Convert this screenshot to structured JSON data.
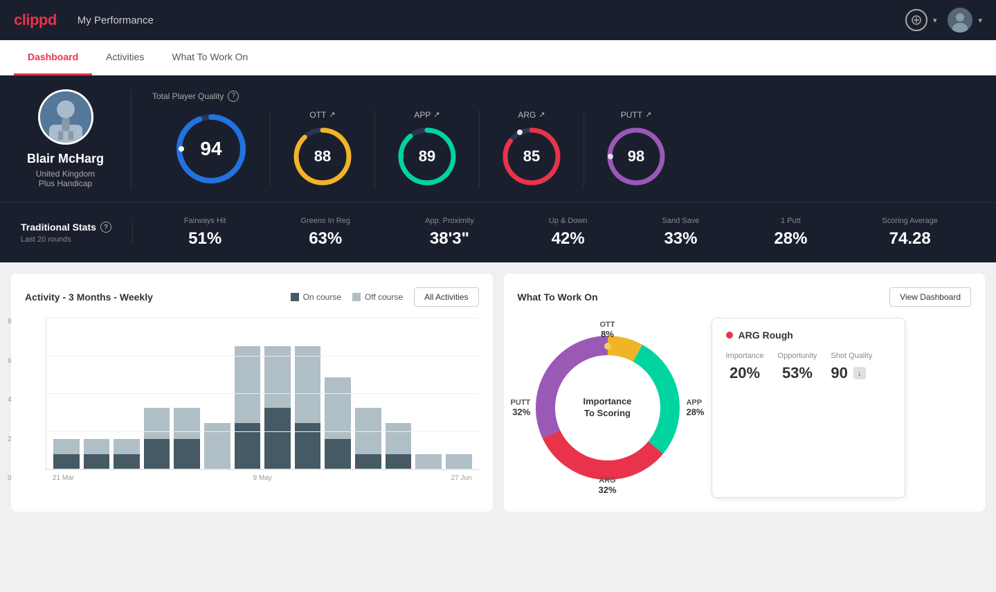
{
  "header": {
    "logo": "clippd",
    "title": "My Performance",
    "add_button_label": "+",
    "chevron": "▾"
  },
  "tabs": [
    {
      "label": "Dashboard",
      "active": true
    },
    {
      "label": "Activities",
      "active": false
    },
    {
      "label": "What To Work On",
      "active": false
    }
  ],
  "hero": {
    "player": {
      "name": "Blair McHarg",
      "country": "United Kingdom",
      "handicap": "Plus Handicap"
    },
    "quality_label": "Total Player Quality",
    "scores": [
      {
        "label": "94",
        "color_start": "#3a7bd5",
        "color_end": "#1e90ff",
        "pct": 94,
        "ring_color": "#2272e0",
        "trail_color": "#2a3555"
      },
      {
        "label": "OTT",
        "value": "88",
        "pct": 88,
        "ring_color": "#f0b429",
        "trail_color": "#2a3555"
      },
      {
        "label": "APP",
        "value": "89",
        "pct": 89,
        "ring_color": "#00d4a0",
        "trail_color": "#2a3555"
      },
      {
        "label": "ARG",
        "value": "85",
        "pct": 85,
        "ring_color": "#e8334a",
        "trail_color": "#2a3555"
      },
      {
        "label": "PUTT",
        "value": "98",
        "pct": 98,
        "ring_color": "#9b59b6",
        "trail_color": "#2a3555"
      }
    ]
  },
  "stats": {
    "section_label": "Traditional Stats",
    "help": "?",
    "rounds_label": "Last 20 rounds",
    "items": [
      {
        "name": "Fairways Hit",
        "value": "51%"
      },
      {
        "name": "Greens In Reg",
        "value": "63%"
      },
      {
        "name": "App. Proximity",
        "value": "38'3\""
      },
      {
        "name": "Up & Down",
        "value": "42%"
      },
      {
        "name": "Sand Save",
        "value": "33%"
      },
      {
        "name": "1 Putt",
        "value": "28%"
      },
      {
        "name": "Scoring Average",
        "value": "74.28"
      }
    ]
  },
  "activity_chart": {
    "title": "Activity - 3 Months - Weekly",
    "legend": [
      {
        "label": "On course",
        "color": "#455a64"
      },
      {
        "label": "Off course",
        "color": "#b0bec5"
      }
    ],
    "all_activities_label": "All Activities",
    "y_labels": [
      "8",
      "6",
      "4",
      "2",
      "0"
    ],
    "x_labels": [
      "21 Mar",
      "9 May",
      "27 Jun"
    ],
    "bars": [
      {
        "on": 1,
        "off": 1
      },
      {
        "on": 1,
        "off": 1
      },
      {
        "on": 1,
        "off": 1
      },
      {
        "on": 2,
        "off": 2
      },
      {
        "on": 2,
        "off": 2
      },
      {
        "on": 0,
        "off": 3
      },
      {
        "on": 3,
        "off": 5
      },
      {
        "on": 4,
        "off": 4
      },
      {
        "on": 3,
        "off": 5
      },
      {
        "on": 2,
        "off": 4
      },
      {
        "on": 1,
        "off": 3
      },
      {
        "on": 1,
        "off": 2
      },
      {
        "on": 0,
        "off": 1
      },
      {
        "on": 0,
        "off": 1
      }
    ]
  },
  "work_on": {
    "title": "What To Work On",
    "view_dashboard_label": "View Dashboard",
    "center_label": "Importance\nTo Scoring",
    "segments": [
      {
        "label": "OTT",
        "value": "8%",
        "color": "#f0b429",
        "pct": 8
      },
      {
        "label": "APP",
        "value": "28%",
        "color": "#00d4a0",
        "pct": 28
      },
      {
        "label": "ARG",
        "value": "32%",
        "color": "#e8334a",
        "pct": 32
      },
      {
        "label": "PUTT",
        "value": "32%",
        "color": "#9b59b6",
        "pct": 32
      }
    ],
    "detail": {
      "title": "ARG Rough",
      "dot_color": "#e8334a",
      "metrics": [
        {
          "label": "Importance",
          "value": "20%"
        },
        {
          "label": "Opportunity",
          "value": "53%"
        },
        {
          "label": "Shot Quality",
          "value": "90",
          "badge": "↓"
        }
      ]
    }
  }
}
